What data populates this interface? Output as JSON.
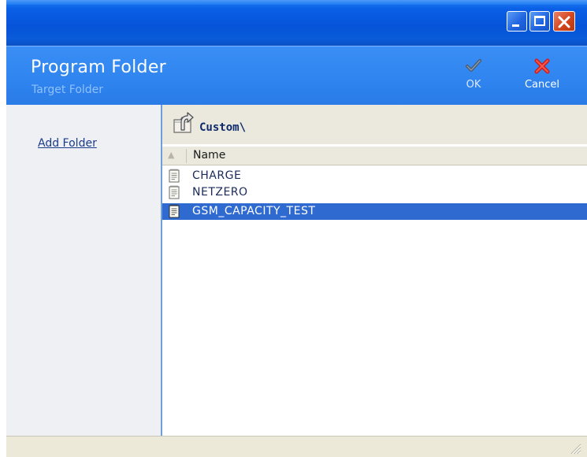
{
  "window": {
    "controls": {
      "minimize_icon": "minimize-icon",
      "maximize_icon": "maximize-icon",
      "close_icon": "close-icon"
    }
  },
  "header": {
    "title": "Program Folder",
    "subtitle": "Target Folder",
    "ok_label": "OK",
    "cancel_label": "Cancel"
  },
  "sidebar": {
    "add_folder_label": "Add Folder"
  },
  "browser": {
    "path": "Custom\\",
    "column_name": "Name",
    "sort_indicator": "▲",
    "rows": [
      {
        "label": "CHARGE",
        "selected": false
      },
      {
        "label": "NETZERO",
        "selected": false
      },
      {
        "label": "GSM_CAPACITY_TEST",
        "selected": true
      }
    ]
  },
  "colors": {
    "titlebar": "#0653d8",
    "header": "#2f84ef",
    "selection": "#2f6ad0",
    "link": "#1a3a8a"
  }
}
